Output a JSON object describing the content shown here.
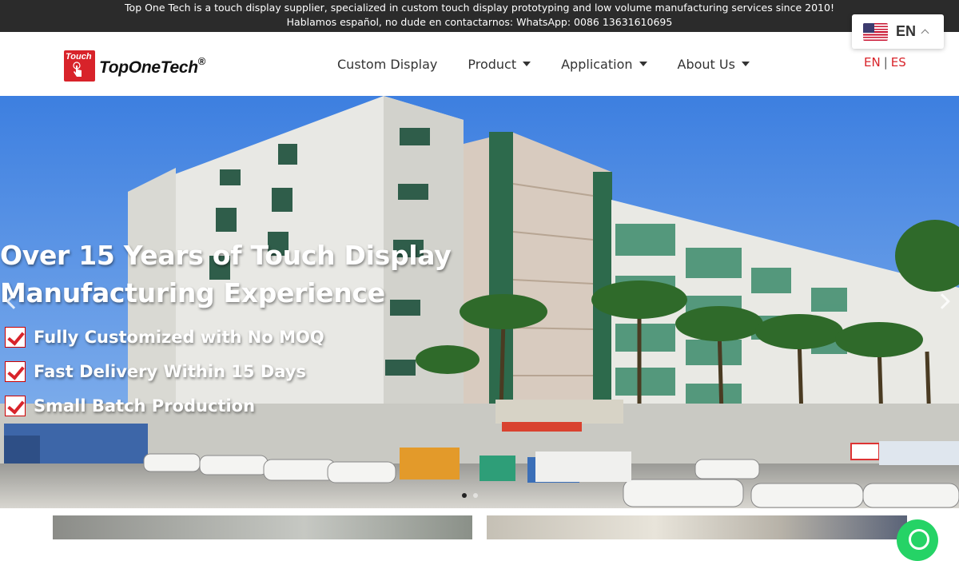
{
  "announcement": {
    "line1": "Top One Tech is a touch display supplier, specialized in custom touch display prototyping and low volume manufacturing services since 2010!",
    "line2": "Hablamos español, no dude en contactarnos: WhatsApp: 0086 13631610695"
  },
  "logo": {
    "badge_text": "Touch",
    "name": "TopOneTech",
    "reg": "®"
  },
  "nav": {
    "items": [
      {
        "label": "Custom Display",
        "has_dropdown": false
      },
      {
        "label": "Product",
        "has_dropdown": true
      },
      {
        "label": "Application",
        "has_dropdown": true
      },
      {
        "label": "About Us",
        "has_dropdown": true
      }
    ]
  },
  "language_links": {
    "en": "EN",
    "sep": "|",
    "es": "ES"
  },
  "language_widget": {
    "code": "EN",
    "flag_icon": "us-flag-icon"
  },
  "hero": {
    "title_line1": "Over 15 Years of Touch Display",
    "title_line2": "Manufacturing Experience",
    "bullets": [
      "Fully Customized with No MOQ",
      "Fast Delivery Within 15 Days",
      "Small Batch Production"
    ],
    "slide_count": 2,
    "active_slide": 1
  },
  "colors": {
    "brand_red": "#d8232a",
    "topbar_bg": "#2b2b2b",
    "whatsapp_green": "#25d366"
  }
}
